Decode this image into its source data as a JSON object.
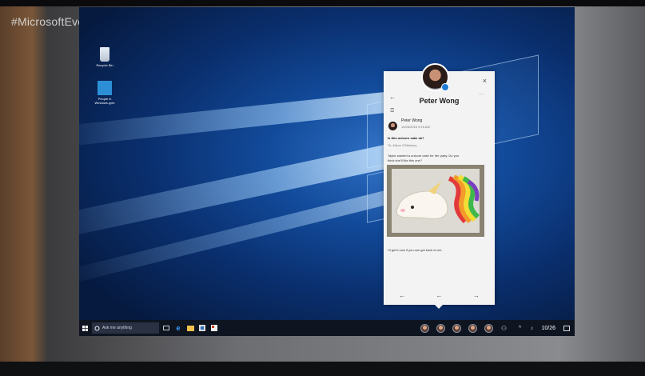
{
  "overlay": {
    "hashtag": "#MicrosoftEvent"
  },
  "desktop": {
    "icons": [
      {
        "label": "Recycle Bin",
        "icon": "recycle-bin-icon"
      },
      {
        "label": "People in Windows.pptx",
        "icon": "pptx-file-icon"
      }
    ]
  },
  "taskbar": {
    "search_placeholder": "Ask me anything",
    "clock": "10/26"
  },
  "people_card": {
    "name": "Peter Wong",
    "message": {
      "sender": "Peter Wong",
      "timestamp": "10/26/2016 9:15 AM",
      "subject": "Is this unicorn cake ok?",
      "recipients": "To: Alison O'Mahony",
      "body": "Taylor wanted a unicorn cake for her party. Do you think she'll like this one?",
      "signoff": "I'll get it now if you can get back to me."
    }
  },
  "colors": {
    "accent": "#1e7bd6",
    "desktop": "#0a2f6e",
    "card": "#f3f3f3"
  }
}
